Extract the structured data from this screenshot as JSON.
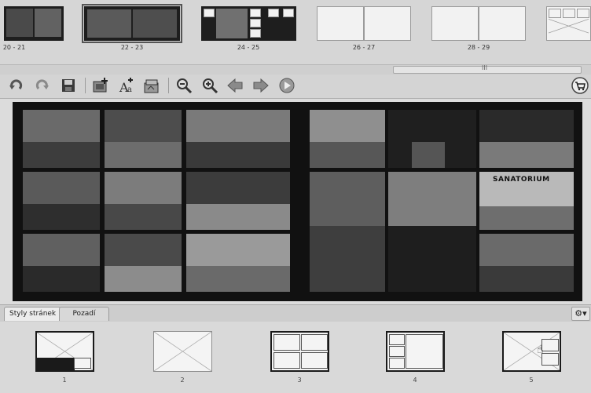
{
  "spreads": [
    {
      "label": "20 - 21",
      "kind": "photos"
    },
    {
      "label": "22 - 23",
      "kind": "photos",
      "selected": true
    },
    {
      "label": "24 - 25",
      "kind": "photos"
    },
    {
      "label": "26 - 27",
      "kind": "blank"
    },
    {
      "label": "28 - 29",
      "kind": "blank"
    },
    {
      "label": "",
      "kind": "placeholder"
    }
  ],
  "scrollbar": {
    "grip": "III"
  },
  "toolbar": {
    "icons": [
      "undo-icon",
      "redo-icon",
      "save-icon",
      "add-page-icon",
      "add-text-icon",
      "image-icon",
      "zoom-out-icon",
      "zoom-in-icon",
      "arrow-left-icon",
      "arrow-right-icon",
      "play-icon",
      "cart-icon"
    ]
  },
  "spread_text": {
    "sign": "SANATORIUM"
  },
  "tabs": {
    "page_styles": "Styly stránek",
    "background": "Pozadí"
  },
  "layouts": [
    {
      "number": "1",
      "style": "framed"
    },
    {
      "number": "2",
      "style": "plain"
    },
    {
      "number": "3",
      "style": "framed"
    },
    {
      "number": "4",
      "style": "framed"
    },
    {
      "number": "5",
      "style": "framed"
    }
  ],
  "colors": {
    "background": "#cfcfcf",
    "frame": "#111111",
    "panel": "#d9d9d9"
  }
}
